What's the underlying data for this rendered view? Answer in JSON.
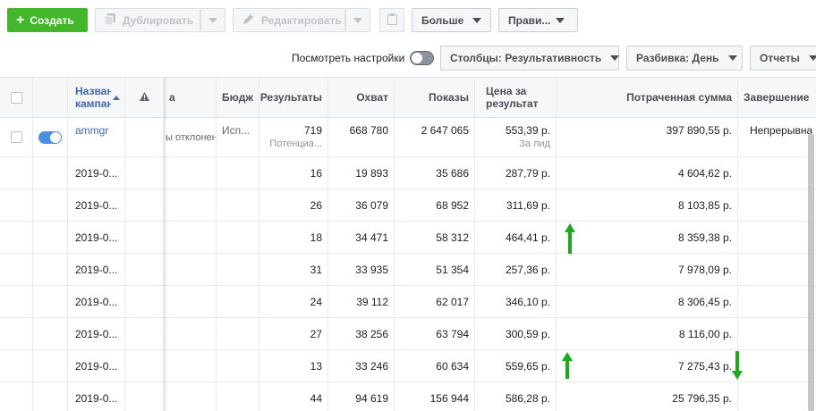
{
  "toolbar": {
    "create_label": "Создать",
    "duplicate_label": "Дублировать",
    "edit_label": "Редактировать",
    "more_label": "Больше",
    "rules_label": "Прави..."
  },
  "subbar": {
    "view_settings_label": "Посмотреть настройки",
    "columns_label": "Столбцы: Результативность",
    "breakdown_label": "Разбивка: День",
    "reports_label": "Отчеты"
  },
  "table": {
    "headers": {
      "name": "Назван кампан",
      "delivery_partial": "а",
      "budget": "Бюдж",
      "results": "Результаты",
      "reach": "Охват",
      "impressions": "Показы",
      "cost_per_result": "Цена за результат",
      "amount_spent": "Потраченная сумма",
      "ends": "Завершение"
    },
    "campaign_row": {
      "name": "ammgr",
      "delivery": "ы отклонен",
      "budget": "Исп...",
      "results": "719",
      "results_sub": "Потенциа...",
      "reach": "668 780",
      "impressions": "2 647 065",
      "cost_per_result": "553,39 р.",
      "cost_sub": "За лид",
      "amount_spent": "397 890,55 р.",
      "ends": "Непрерывна"
    },
    "rows": [
      {
        "date": "2019-0...",
        "results": "16",
        "reach": "19 893",
        "impressions": "35 686",
        "cost": "287,79 р.",
        "spent": "4 604,62 р."
      },
      {
        "date": "2019-0...",
        "results": "26",
        "reach": "36 079",
        "impressions": "68 952",
        "cost": "311,69 р.",
        "spent": "8 103,85 р."
      },
      {
        "date": "2019-0...",
        "results": "18",
        "reach": "34 471",
        "impressions": "58 312",
        "cost": "464,41 р.",
        "spent": "8 359,38 р."
      },
      {
        "date": "2019-0...",
        "results": "31",
        "reach": "33 935",
        "impressions": "51 354",
        "cost": "257,36 р.",
        "spent": "7 978,09 р."
      },
      {
        "date": "2019-0...",
        "results": "24",
        "reach": "39 112",
        "impressions": "62 017",
        "cost": "346,10 р.",
        "spent": "8 306,45 р."
      },
      {
        "date": "2019-0...",
        "results": "27",
        "reach": "38 256",
        "impressions": "63 794",
        "cost": "300,59 р.",
        "spent": "8 116,00 р."
      },
      {
        "date": "2019-0...",
        "results": "13",
        "reach": "33 246",
        "impressions": "60 634",
        "cost": "559,65 р.",
        "spent": "7 275,43 р."
      },
      {
        "date": "2019-0...",
        "results": "44",
        "reach": "94 619",
        "impressions": "156 944",
        "cost": "586,28 р.",
        "spent": "25 796,35 р."
      }
    ]
  },
  "colors": {
    "create_green": "#42b72a",
    "link_blue": "#4267b2",
    "annotation_arrow": "#1aaa1a"
  },
  "icons": [
    "plus-icon",
    "duplicate-icon",
    "pencil-icon",
    "clipboard-icon",
    "warning-icon",
    "sort-up-icon",
    "caret-down-icon"
  ]
}
